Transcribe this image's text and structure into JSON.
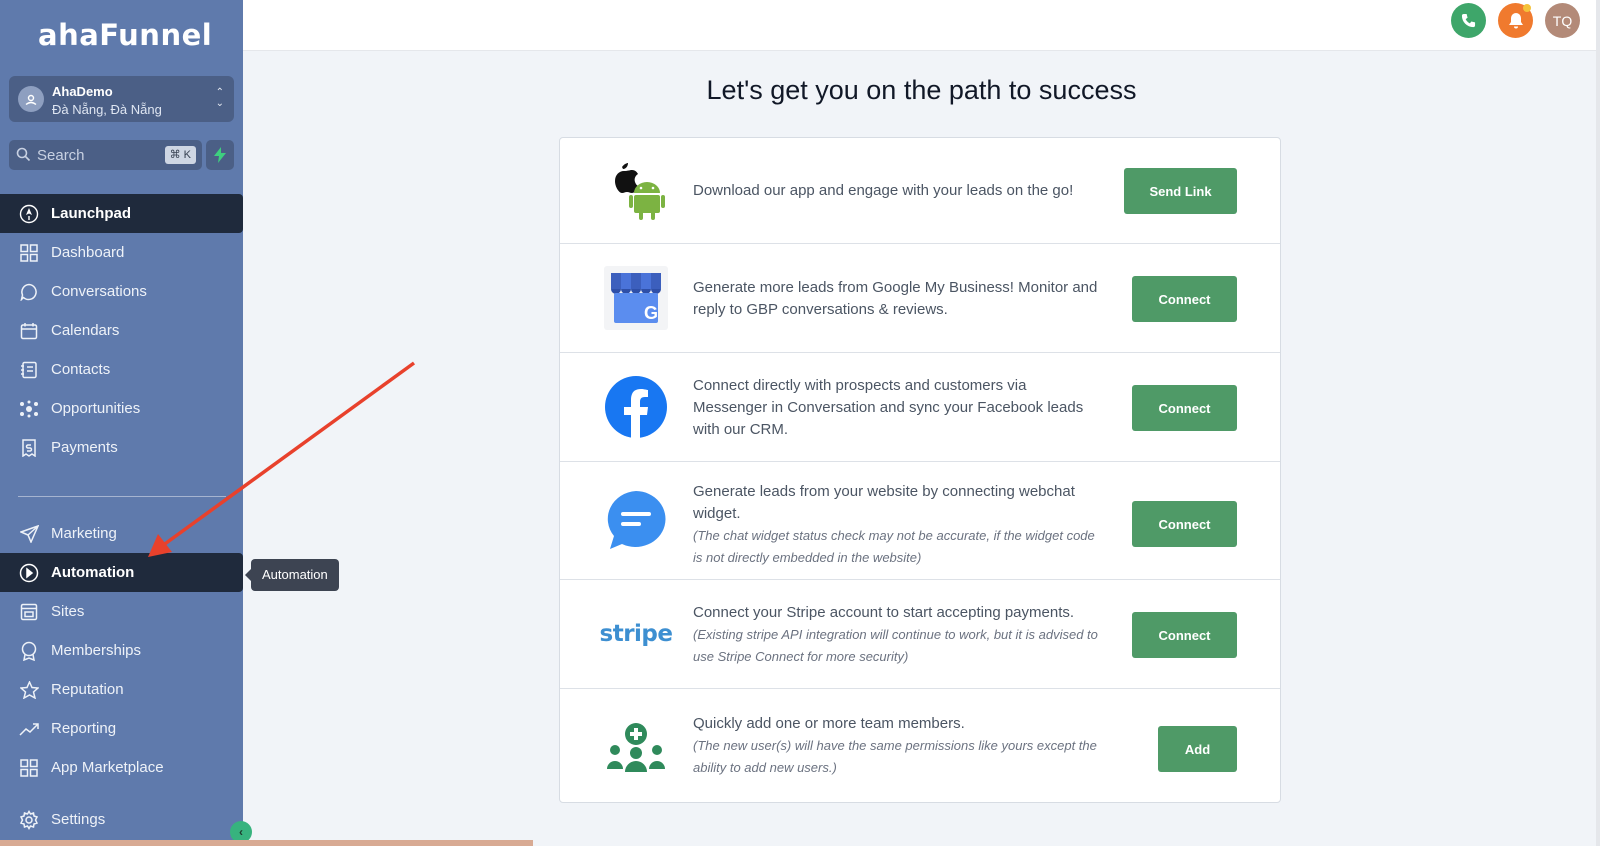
{
  "sidebar": {
    "logo_text": "ahaFunnel",
    "account": {
      "name": "AhaDemo",
      "location": "Đà Nẵng, Đà Nẵng"
    },
    "search": {
      "placeholder": "Search",
      "shortcut": "⌘ K"
    },
    "items": [
      {
        "label": "Launchpad",
        "icon": "launchpad-icon",
        "active": true
      },
      {
        "label": "Dashboard",
        "icon": "dashboard-icon"
      },
      {
        "label": "Conversations",
        "icon": "chat-icon"
      },
      {
        "label": "Calendars",
        "icon": "calendar-icon"
      },
      {
        "label": "Contacts",
        "icon": "contacts-icon"
      },
      {
        "label": "Opportunities",
        "icon": "opportunities-icon"
      },
      {
        "label": "Payments",
        "icon": "payments-icon"
      },
      {
        "label": "Marketing",
        "icon": "send-icon"
      },
      {
        "label": "Automation",
        "icon": "automation-icon",
        "active": true
      },
      {
        "label": "Sites",
        "icon": "sites-icon"
      },
      {
        "label": "Memberships",
        "icon": "badge-icon"
      },
      {
        "label": "Reputation",
        "icon": "star-icon"
      },
      {
        "label": "Reporting",
        "icon": "trend-icon"
      },
      {
        "label": "App Marketplace",
        "icon": "grid-icon"
      },
      {
        "label": "Settings",
        "icon": "gear-icon"
      }
    ]
  },
  "tooltip": {
    "text": "Automation"
  },
  "header": {
    "user_initials": "TQ"
  },
  "main": {
    "title": "Let's get you on the path to success",
    "rows": [
      {
        "icon": "apple-android-icon",
        "text": "Download our app and engage with your leads on the go!",
        "note": "",
        "button": "Send Link"
      },
      {
        "icon": "google-my-business-icon",
        "text": "Generate more leads from Google My Business! Monitor and reply to GBP conversations & reviews.",
        "note": "",
        "button": "Connect"
      },
      {
        "icon": "facebook-icon",
        "text": "Connect directly with prospects and customers via Messenger in Conversation and sync your Facebook leads with our CRM.",
        "note": "",
        "button": "Connect"
      },
      {
        "icon": "webchat-icon",
        "text": "Generate leads from your website by connecting webchat widget.",
        "note": "(The chat widget status check may not be accurate, if the widget code is not directly embedded in the website)",
        "button": "Connect"
      },
      {
        "icon": "stripe-icon",
        "logo_text": "stripe",
        "text": "Connect your Stripe account to start accepting payments.",
        "note": "(Existing stripe API integration will continue to work, but it is advised to use Stripe Connect for more security)",
        "button": "Connect"
      },
      {
        "icon": "team-add-icon",
        "text": "Quickly add one or more team members.",
        "note": "(The new user(s) will have the same permissions like yours except the ability to add new users.)",
        "button": "Add"
      }
    ]
  },
  "colors": {
    "sidebar": "#5f7aac",
    "active": "#1f2a3c",
    "button": "#4f9a67",
    "arrow": "#e8412c"
  }
}
